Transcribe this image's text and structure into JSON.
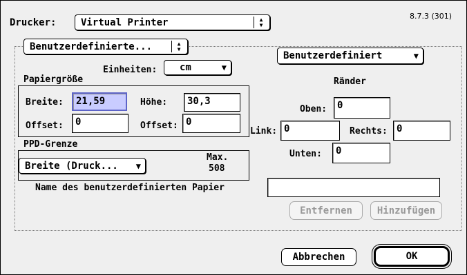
{
  "header": {
    "printer_label": "Drucker:",
    "printer_value": "Virtual Printer",
    "version": "8.7.3 (301)"
  },
  "section": {
    "type_popup": "Benutzerdefinierte...",
    "units_label": "Einheiten:",
    "units_value": "cm",
    "margin_popup": "Benutzerdefiniert"
  },
  "papiergroesse": {
    "title": "Papiergröße",
    "width_label": "Breite:",
    "width_value": "21,59",
    "height_label": "Höhe:",
    "height_value": "30,3",
    "offset_label1": "Offset:",
    "offset_value1": "0",
    "offset_label2": "Offset:",
    "offset_value2": "0"
  },
  "ppd": {
    "title": "PPD-Grenze",
    "popup": "Breite (Druck...",
    "max_label": "Max.",
    "max_value": "508"
  },
  "raender": {
    "title": "Ränder",
    "top_label": "Oben:",
    "top_value": "0",
    "left_label": "Link:",
    "left_value": "0",
    "right_label": "Rechts:",
    "right_value": "0",
    "bottom_label": "Unten:",
    "bottom_value": "0"
  },
  "custom": {
    "name_label": "Name des benutzerdefinierten Papier",
    "name_value": "",
    "remove_label": "Entfernen",
    "add_label": "Hinzufügen"
  },
  "footer": {
    "cancel_label": "Abbrechen",
    "ok_label": "OK"
  },
  "icons": {
    "popup_arrow": "▼",
    "updown_up": "▲",
    "updown_down": "▼"
  }
}
